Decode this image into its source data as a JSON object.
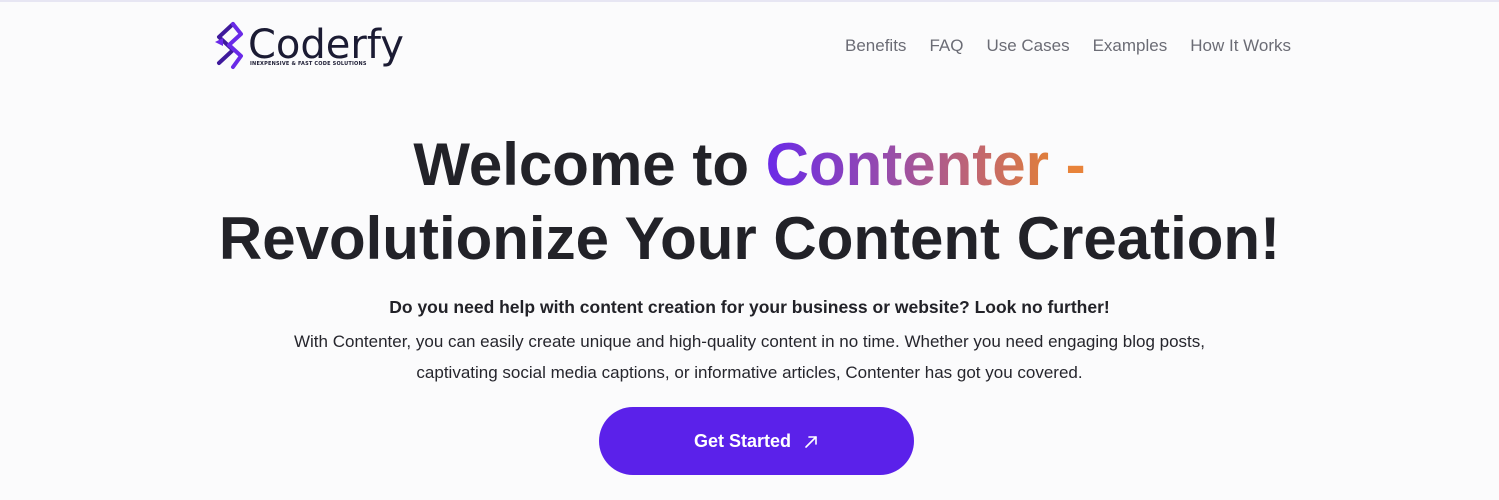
{
  "brand": {
    "name": "Coderfy",
    "tagline": "INEXPENSIVE & FAST CODE SOLUTIONS",
    "logo_icon": "coderfy-c-mark-icon",
    "colors": {
      "mark_primary": "#6a2ae8",
      "mark_secondary": "#3f1a9c",
      "text": "#1b1b33"
    }
  },
  "nav": {
    "items": [
      {
        "label": "Benefits"
      },
      {
        "label": "FAQ"
      },
      {
        "label": "Use Cases"
      },
      {
        "label": "Examples"
      },
      {
        "label": "How It Works"
      }
    ]
  },
  "hero": {
    "title_prefix": "Welcome to ",
    "title_highlight": "Contenter",
    "title_dash": " -",
    "title_line2": "Revolutionize Your Content Creation!",
    "subtitle": "Do you need help with content creation for your business or website? Look no further!",
    "body_line1": "With Contenter, you can easily create unique and high-quality content in no time. Whether you need engaging blog posts,",
    "body_line2": "captivating social media captions, or informative articles, Contenter has got you covered.",
    "cta_label": "Get Started",
    "cta_icon": "arrow-up-right-icon"
  },
  "colors": {
    "background": "#fbfbfc",
    "heading": "#222228",
    "nav_text": "#6b6c75",
    "cta_background": "#5b21ea",
    "gradient_start": "#6a2ae8",
    "gradient_end": "#e07e3b"
  }
}
